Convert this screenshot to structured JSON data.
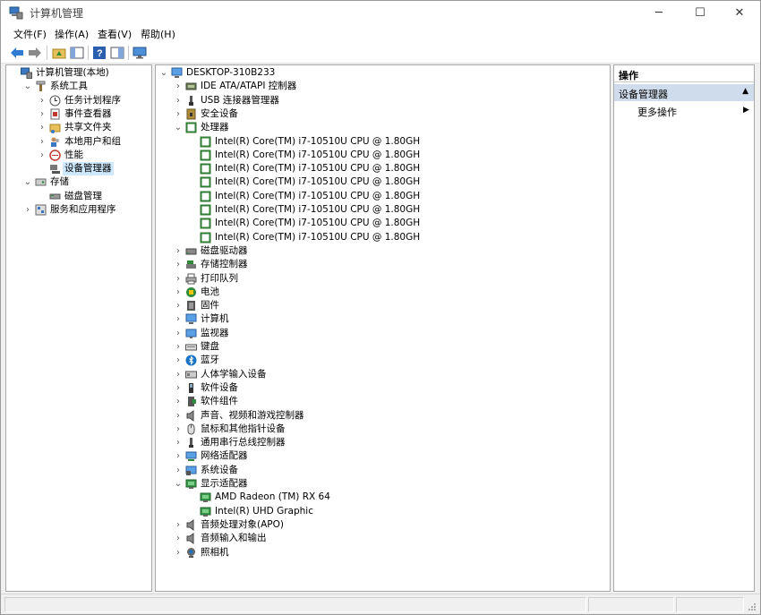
{
  "window": {
    "title": "计算机管理",
    "controls": {
      "minimize": "─",
      "maximize": "☐",
      "close": "✕"
    }
  },
  "menu": [
    "文件(F)",
    "操作(A)",
    "查看(V)",
    "帮助(H)"
  ],
  "toolbar": [
    "back-arrow-icon",
    "forward-arrow-icon",
    "up-folder-icon",
    "show-hide-tree-icon",
    "help-icon",
    "properties-pane-icon",
    "monitor-icon"
  ],
  "left_tree": [
    {
      "label": "计算机管理(本地)",
      "level": 0,
      "expander": "",
      "icon": "computer-management-icon"
    },
    {
      "label": "系统工具",
      "level": 1,
      "expander": "v",
      "icon": "tools-icon"
    },
    {
      "label": "任务计划程序",
      "level": 2,
      "expander": ">",
      "icon": "clock-icon"
    },
    {
      "label": "事件查看器",
      "level": 2,
      "expander": ">",
      "icon": "event-viewer-icon"
    },
    {
      "label": "共享文件夹",
      "level": 2,
      "expander": ">",
      "icon": "shared-folder-icon"
    },
    {
      "label": "本地用户和组",
      "level": 2,
      "expander": ">",
      "icon": "users-icon"
    },
    {
      "label": "性能",
      "level": 2,
      "expander": ">",
      "icon": "performance-icon"
    },
    {
      "label": "设备管理器",
      "level": 2,
      "expander": "",
      "icon": "device-manager-icon",
      "selected": true
    },
    {
      "label": "存储",
      "level": 1,
      "expander": "v",
      "icon": "storage-icon"
    },
    {
      "label": "磁盘管理",
      "level": 2,
      "expander": "",
      "icon": "disk-icon"
    },
    {
      "label": "服务和应用程序",
      "level": 1,
      "expander": ">",
      "icon": "services-icon"
    }
  ],
  "device_tree": [
    {
      "label": "DESKTOP-310B233",
      "level": 0,
      "expander": "v",
      "icon": "computer-icon"
    },
    {
      "label": "IDE ATA/ATAPI 控制器",
      "level": 1,
      "expander": ">",
      "icon": "ide-controller-icon"
    },
    {
      "label": "USB 连接器管理器",
      "level": 1,
      "expander": ">",
      "icon": "usb-icon"
    },
    {
      "label": "安全设备",
      "level": 1,
      "expander": ">",
      "icon": "security-device-icon"
    },
    {
      "label": "处理器",
      "level": 1,
      "expander": "v",
      "icon": "processor-icon"
    },
    {
      "label": "Intel(R) Core(TM) i7-10510U CPU @ 1.80GH",
      "level": 2,
      "expander": "",
      "icon": "processor-icon"
    },
    {
      "label": "Intel(R) Core(TM) i7-10510U CPU @ 1.80GH",
      "level": 2,
      "expander": "",
      "icon": "processor-icon"
    },
    {
      "label": "Intel(R) Core(TM) i7-10510U CPU @ 1.80GH",
      "level": 2,
      "expander": "",
      "icon": "processor-icon"
    },
    {
      "label": "Intel(R) Core(TM) i7-10510U CPU @ 1.80GH",
      "level": 2,
      "expander": "",
      "icon": "processor-icon"
    },
    {
      "label": "Intel(R) Core(TM) i7-10510U CPU @ 1.80GH",
      "level": 2,
      "expander": "",
      "icon": "processor-icon"
    },
    {
      "label": "Intel(R) Core(TM) i7-10510U CPU @ 1.80GH",
      "level": 2,
      "expander": "",
      "icon": "processor-icon"
    },
    {
      "label": "Intel(R) Core(TM) i7-10510U CPU @ 1.80GH",
      "level": 2,
      "expander": "",
      "icon": "processor-icon"
    },
    {
      "label": "Intel(R) Core(TM) i7-10510U CPU @ 1.80GH",
      "level": 2,
      "expander": "",
      "icon": "processor-icon"
    },
    {
      "label": "磁盘驱动器",
      "level": 1,
      "expander": ">",
      "icon": "disk-drive-icon"
    },
    {
      "label": "存储控制器",
      "level": 1,
      "expander": ">",
      "icon": "storage-controller-icon"
    },
    {
      "label": "打印队列",
      "level": 1,
      "expander": ">",
      "icon": "printer-icon"
    },
    {
      "label": "电池",
      "level": 1,
      "expander": ">",
      "icon": "battery-icon"
    },
    {
      "label": "固件",
      "level": 1,
      "expander": ">",
      "icon": "firmware-icon"
    },
    {
      "label": "计算机",
      "level": 1,
      "expander": ">",
      "icon": "computer-icon"
    },
    {
      "label": "监视器",
      "level": 1,
      "expander": ">",
      "icon": "monitor-icon"
    },
    {
      "label": "键盘",
      "level": 1,
      "expander": ">",
      "icon": "keyboard-icon"
    },
    {
      "label": "蓝牙",
      "level": 1,
      "expander": ">",
      "icon": "bluetooth-icon"
    },
    {
      "label": "人体学输入设备",
      "level": 1,
      "expander": ">",
      "icon": "hid-icon"
    },
    {
      "label": "软件设备",
      "level": 1,
      "expander": ">",
      "icon": "software-device-icon"
    },
    {
      "label": "软件组件",
      "level": 1,
      "expander": ">",
      "icon": "software-component-icon"
    },
    {
      "label": "声音、视频和游戏控制器",
      "level": 1,
      "expander": ">",
      "icon": "speaker-icon"
    },
    {
      "label": "鼠标和其他指针设备",
      "level": 1,
      "expander": ">",
      "icon": "mouse-icon"
    },
    {
      "label": "通用串行总线控制器",
      "level": 1,
      "expander": ">",
      "icon": "usb-controller-icon"
    },
    {
      "label": "网络适配器",
      "level": 1,
      "expander": ">",
      "icon": "network-adapter-icon"
    },
    {
      "label": "系统设备",
      "level": 1,
      "expander": ">",
      "icon": "system-device-icon"
    },
    {
      "label": "显示适配器",
      "level": 1,
      "expander": "v",
      "icon": "display-adapter-icon"
    },
    {
      "label": "AMD Radeon (TM) RX 64",
      "level": 2,
      "expander": "",
      "icon": "display-adapter-icon"
    },
    {
      "label": "Intel(R) UHD Graphic",
      "level": 2,
      "expander": "",
      "icon": "display-adapter-icon"
    },
    {
      "label": "音频处理对象(APO)",
      "level": 1,
      "expander": ">",
      "icon": "audio-icon"
    },
    {
      "label": "音频输入和输出",
      "level": 1,
      "expander": ">",
      "icon": "audio-icon"
    },
    {
      "label": "照相机",
      "level": 1,
      "expander": ">",
      "icon": "camera-icon"
    }
  ],
  "actions": {
    "header": "操作",
    "section": "设备管理器",
    "section_arrow": "▲",
    "more": "更多操作",
    "more_arrow": "▶"
  },
  "colors": {
    "selection": "#cde8ff",
    "actions_section": "#cfdcec",
    "processor_icon": "#2f7d32",
    "accent_blue": "#1a73c7"
  }
}
